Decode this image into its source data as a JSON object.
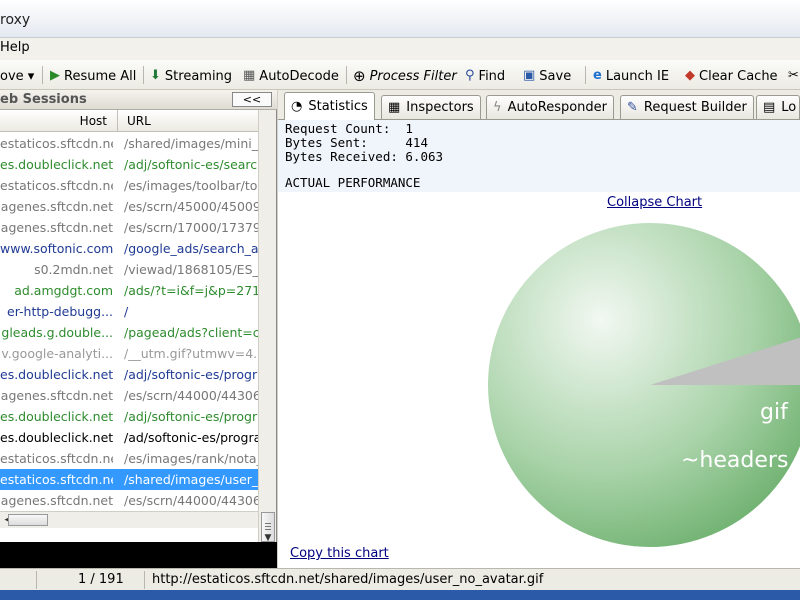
{
  "window": {
    "title": "roxy"
  },
  "menu": {
    "items": [
      "Help"
    ]
  },
  "toolbar": {
    "remove": "ove ▾",
    "resume_all": "Resume All",
    "streaming": "Streaming",
    "autodecode": "AutoDecode",
    "process_filter": "Process Filter",
    "find": "Find",
    "save": "Save",
    "launch_ie": "Launch IE",
    "clear_cache": "Clear Cache"
  },
  "sessions": {
    "title": "eb Sessions",
    "collapse": "<<",
    "col_host": "Host",
    "col_url": "URL",
    "rows": [
      {
        "host": "estaticos.sftcdn.net",
        "url": "/shared/images/mini_s",
        "color": "#777777"
      },
      {
        "host": "es.doubleclick.net",
        "url": "/adj/softonic-es/searc",
        "color": "#2e8b2e"
      },
      {
        "host": "estaticos.sftcdn.net",
        "url": "/es/images/toolbar/too",
        "color": "#777777"
      },
      {
        "host": "agenes.sftcdn.net",
        "url": "/es/scrn/45000/45009",
        "color": "#777777"
      },
      {
        "host": "agenes.sftcdn.net",
        "url": "/es/scrn/17000/17379",
        "color": "#777777"
      },
      {
        "host": "www.softonic.com",
        "url": "/google_ads/search_a",
        "color": "#1f3a93"
      },
      {
        "host": "s0.2mdn.net",
        "url": "/viewad/1868105/ES_",
        "color": "#777777"
      },
      {
        "host": "ad.amgdgt.com",
        "url": "/ads/?t=i&f=j&p=271",
        "color": "#2e8b2e"
      },
      {
        "host": "er-http-debugg...",
        "url": "/",
        "color": "#1f3a93"
      },
      {
        "host": "gleads.g.double...",
        "url": "/pagead/ads?client=ca",
        "color": "#2e8b2e"
      },
      {
        "host": "v.google-analyti...",
        "url": "/__utm.gif?utmwv=4.",
        "color": "#999999"
      },
      {
        "host": "es.doubleclick.net",
        "url": "/adj/softonic-es/progr",
        "color": "#1f3a93"
      },
      {
        "host": "agenes.sftcdn.net",
        "url": "/es/scrn/44000/44306",
        "color": "#777777"
      },
      {
        "host": "es.doubleclick.net",
        "url": "/adj/softonic-es/progr",
        "color": "#2e8b2e"
      },
      {
        "host": "es.doubleclick.net",
        "url": "/ad/softonic-es/progra",
        "color": "#000000"
      },
      {
        "host": "estaticos.sftcdn.net",
        "url": "/es/images/rank/nota_",
        "color": "#777777"
      },
      {
        "host": "estaticos.sftcdn.net",
        "url": "/shared/images/user_",
        "color": "#ffffff",
        "selected": true
      },
      {
        "host": "agenes.sftcdn.net",
        "url": "/es/scrn/44000/44306",
        "color": "#777777"
      }
    ]
  },
  "tabs": {
    "statistics": "Statistics",
    "inspectors": "Inspectors",
    "autoresponder": "AutoResponder",
    "request_builder": "Request Builder",
    "log": "Lo"
  },
  "stats": {
    "request_count": "Request Count:  1",
    "bytes_sent": "Bytes Sent:     414",
    "bytes_received": "Bytes Received: 6.063",
    "actual_performance": "ACTUAL PERFORMANCE"
  },
  "chart": {
    "collapse": "Collapse Chart",
    "copy": "Copy this chart",
    "label_gif": "gif",
    "label_headers": "~headers"
  },
  "status": {
    "count": "1 / 191",
    "url": "http://estaticos.sftcdn.net/shared/images/user_no_avatar.gif"
  }
}
